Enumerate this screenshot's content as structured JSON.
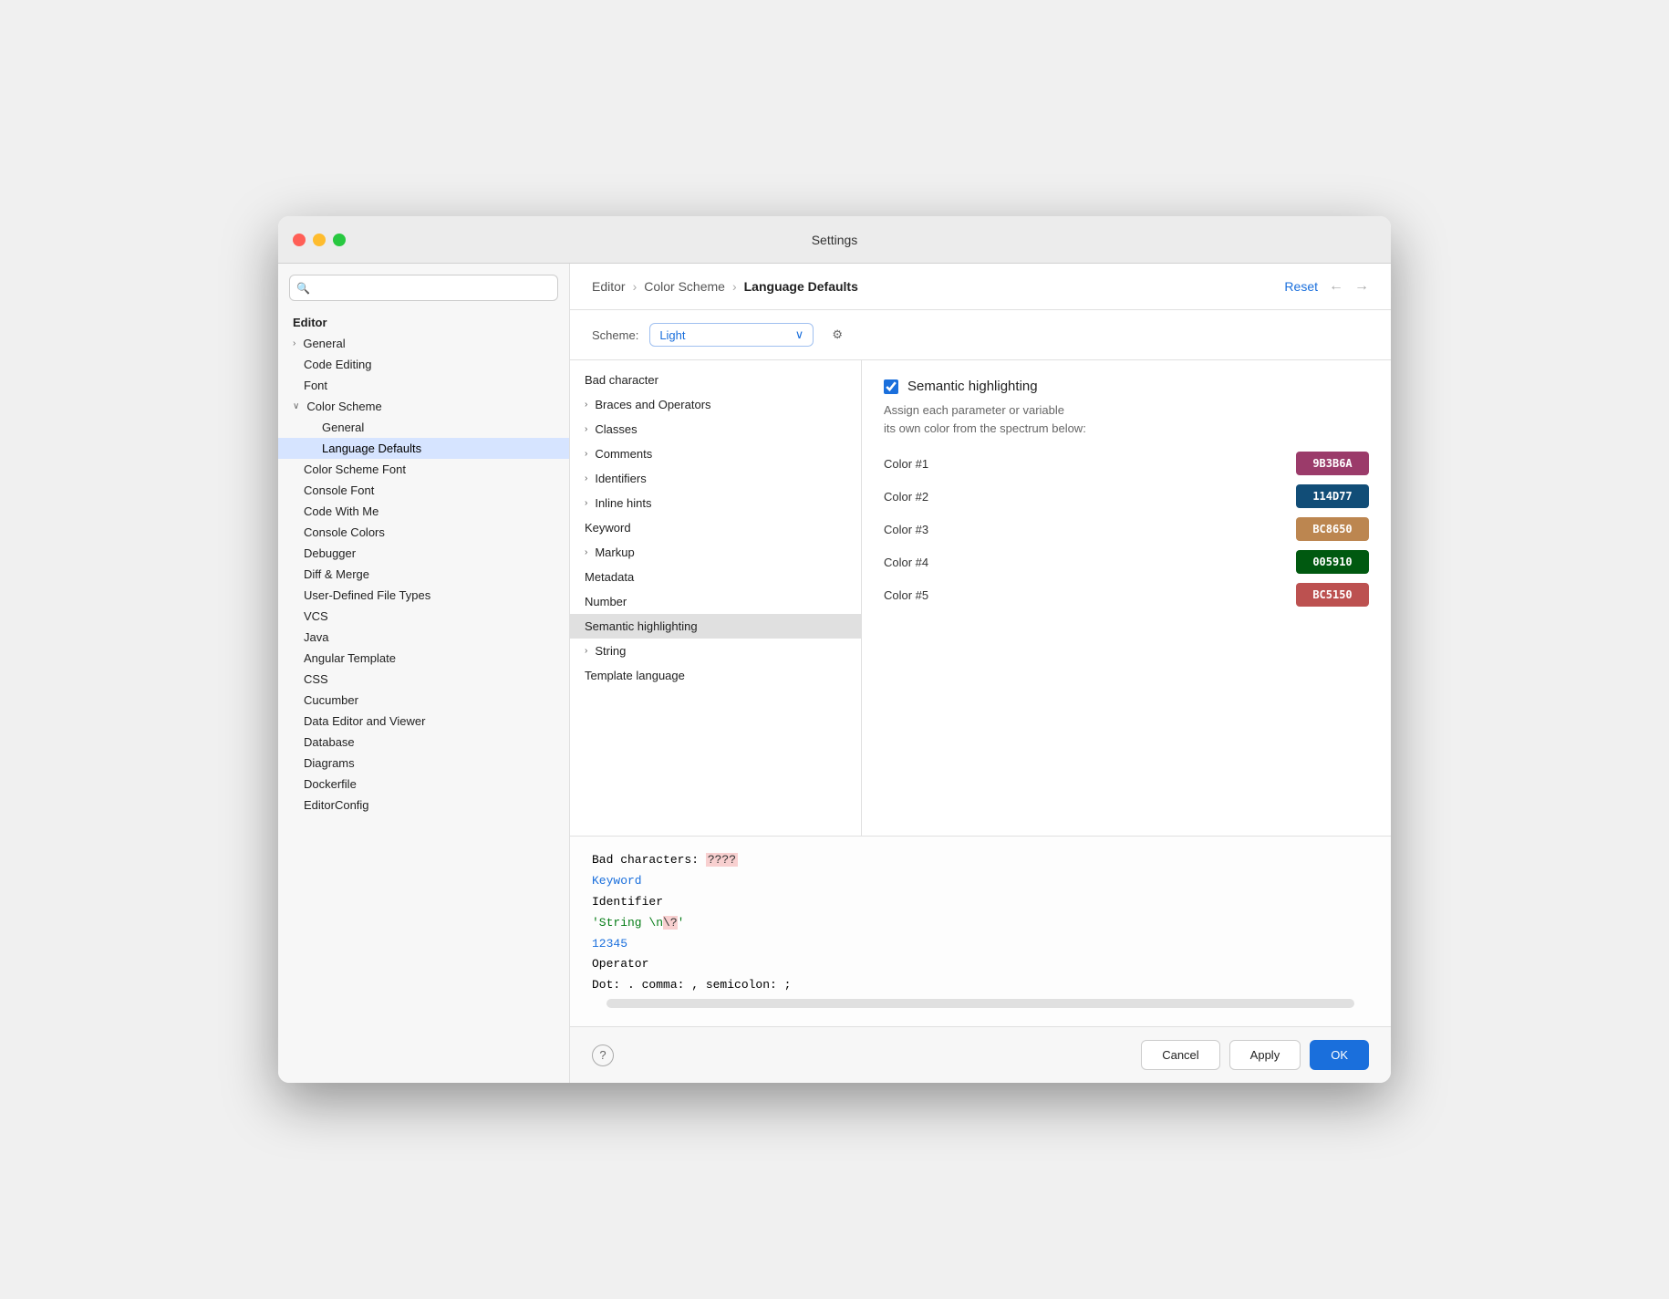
{
  "window": {
    "title": "Settings"
  },
  "sidebar": {
    "search_placeholder": "🔍",
    "section_editor": "Editor",
    "items": [
      {
        "id": "general",
        "label": "General",
        "indent": 1,
        "chevron": true
      },
      {
        "id": "code-editing",
        "label": "Code Editing",
        "indent": 0
      },
      {
        "id": "font",
        "label": "Font",
        "indent": 0
      },
      {
        "id": "color-scheme",
        "label": "Color Scheme",
        "indent": 0,
        "chevron": true,
        "expanded": true
      },
      {
        "id": "cs-general",
        "label": "General",
        "indent": 1
      },
      {
        "id": "language-defaults",
        "label": "Language Defaults",
        "indent": 1,
        "active": true
      },
      {
        "id": "color-scheme-font",
        "label": "Color Scheme Font",
        "indent": 0
      },
      {
        "id": "console-font",
        "label": "Console Font",
        "indent": 0
      },
      {
        "id": "code-with-me",
        "label": "Code With Me",
        "indent": 0
      },
      {
        "id": "console-colors",
        "label": "Console Colors",
        "indent": 0
      },
      {
        "id": "debugger",
        "label": "Debugger",
        "indent": 0
      },
      {
        "id": "diff-merge",
        "label": "Diff & Merge",
        "indent": 0
      },
      {
        "id": "user-defined-file-types",
        "label": "User-Defined File Types",
        "indent": 0
      },
      {
        "id": "vcs",
        "label": "VCS",
        "indent": 0
      },
      {
        "id": "java",
        "label": "Java",
        "indent": 0
      },
      {
        "id": "angular-template",
        "label": "Angular Template",
        "indent": 0
      },
      {
        "id": "css",
        "label": "CSS",
        "indent": 0
      },
      {
        "id": "cucumber",
        "label": "Cucumber",
        "indent": 0
      },
      {
        "id": "data-editor-viewer",
        "label": "Data Editor and Viewer",
        "indent": 0
      },
      {
        "id": "database",
        "label": "Database",
        "indent": 0
      },
      {
        "id": "diagrams",
        "label": "Diagrams",
        "indent": 0
      },
      {
        "id": "dockerfile",
        "label": "Dockerfile",
        "indent": 0
      },
      {
        "id": "editorconfig",
        "label": "EditorConfig",
        "indent": 0
      }
    ]
  },
  "header": {
    "breadcrumb": [
      "Editor",
      "Color Scheme",
      "Language Defaults"
    ],
    "reset_label": "Reset"
  },
  "scheme": {
    "label": "Scheme:",
    "value": "Light"
  },
  "list_items": [
    {
      "id": "bad-character",
      "label": "Bad character",
      "chevron": false
    },
    {
      "id": "braces-operators",
      "label": "Braces and Operators",
      "chevron": true
    },
    {
      "id": "classes",
      "label": "Classes",
      "chevron": true
    },
    {
      "id": "comments",
      "label": "Comments",
      "chevron": true
    },
    {
      "id": "identifiers",
      "label": "Identifiers",
      "chevron": true
    },
    {
      "id": "inline-hints",
      "label": "Inline hints",
      "chevron": true
    },
    {
      "id": "keyword",
      "label": "Keyword",
      "chevron": false
    },
    {
      "id": "markup",
      "label": "Markup",
      "chevron": true
    },
    {
      "id": "metadata",
      "label": "Metadata",
      "chevron": false
    },
    {
      "id": "number",
      "label": "Number",
      "chevron": false
    },
    {
      "id": "semantic-highlighting",
      "label": "Semantic highlighting",
      "chevron": false,
      "active": true
    },
    {
      "id": "string",
      "label": "String",
      "chevron": true
    },
    {
      "id": "template-language",
      "label": "Template language",
      "chevron": false
    }
  ],
  "semantic": {
    "checkbox_checked": true,
    "title": "Semantic highlighting",
    "description_line1": "Assign each parameter or variable",
    "description_line2": "its own color from the spectrum below:",
    "colors": [
      {
        "label": "Color #1",
        "hex": "9B3B6A",
        "bg": "#9B3B6A"
      },
      {
        "label": "Color #2",
        "hex": "114D77",
        "bg": "#114D77"
      },
      {
        "label": "Color #3",
        "hex": "BC8650",
        "bg": "#BC8650"
      },
      {
        "label": "Color #4",
        "hex": "005910",
        "bg": "#005910"
      },
      {
        "label": "Color #5",
        "hex": "BC5150",
        "bg": "#BC5150"
      }
    ]
  },
  "preview": {
    "lines": [
      {
        "type": "bad-chars",
        "text1": "Bad characters: ",
        "highlight": "????"
      },
      {
        "type": "keyword",
        "text": "Keyword"
      },
      {
        "type": "plain",
        "text": "Identifier"
      },
      {
        "type": "string",
        "text": "'String \\n\\?'"
      },
      {
        "type": "number",
        "text": "12345"
      },
      {
        "type": "plain",
        "text": "Operator"
      },
      {
        "type": "plain",
        "text": "Dot: . comma: , semicolon: ;"
      }
    ]
  },
  "footer": {
    "help_label": "?",
    "cancel_label": "Cancel",
    "apply_label": "Apply",
    "ok_label": "OK"
  }
}
